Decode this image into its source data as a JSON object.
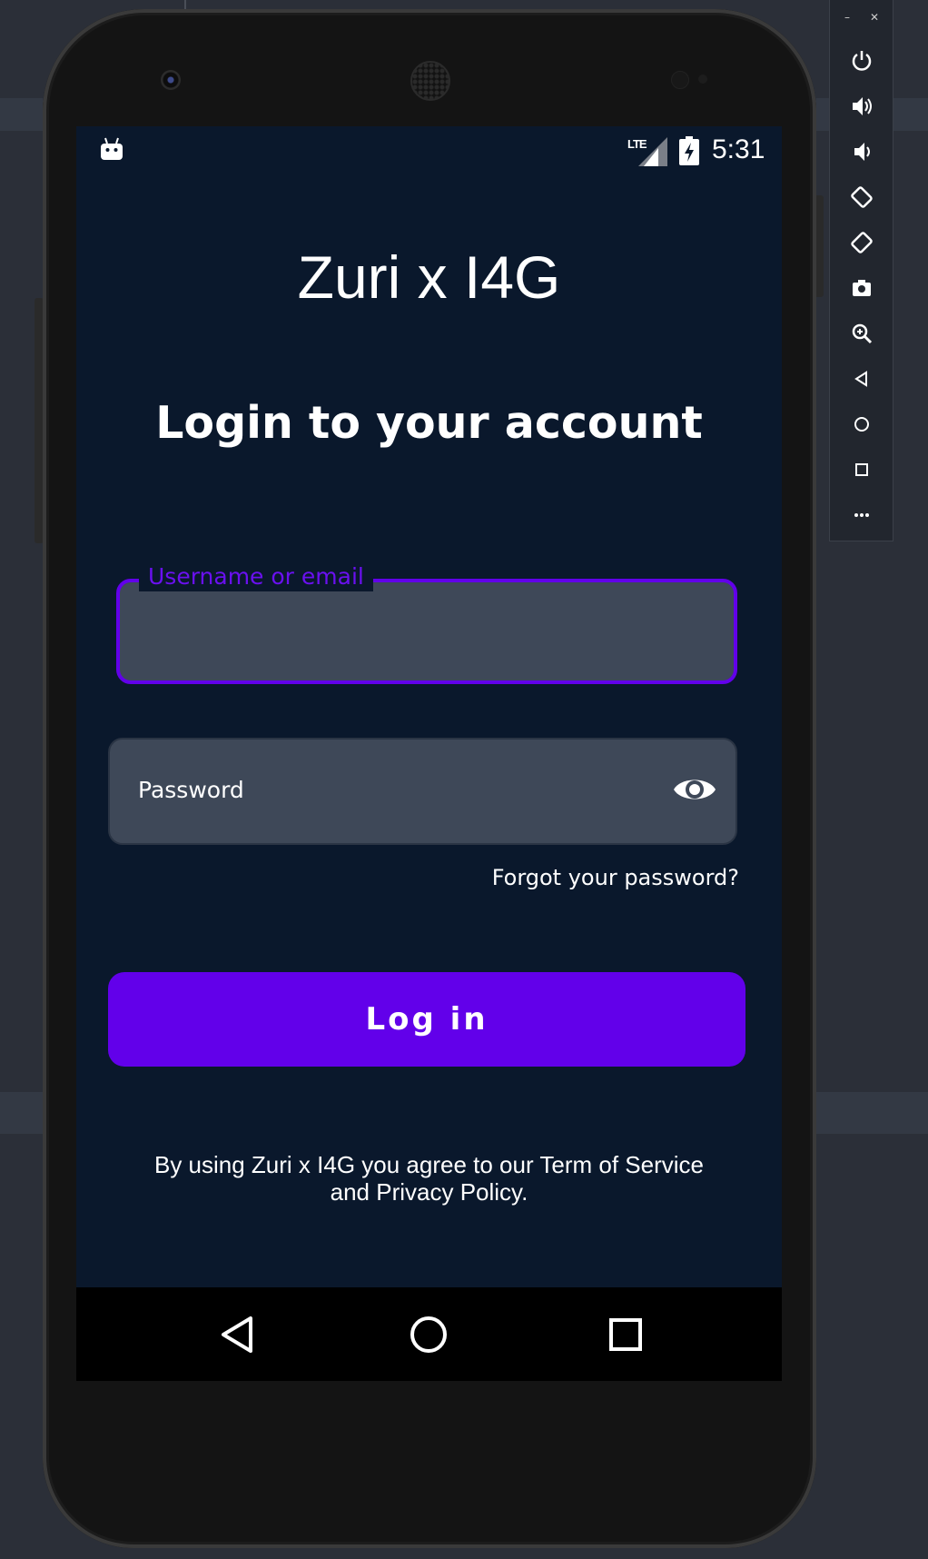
{
  "status_bar": {
    "network": "LTE",
    "time": "5:31"
  },
  "app": {
    "title": "Zuri x I4G",
    "heading": "Login to your account"
  },
  "form": {
    "username_label": "Username or email",
    "password_placeholder": "Password",
    "forgot_link": "Forgot your password?",
    "login_button": "Log in"
  },
  "footer": {
    "terms_line1": "By using Zuri x I4G you agree to our Term of Service",
    "terms_line2": "and Privacy Policy."
  },
  "colors": {
    "screen_bg": "#0a182c",
    "accent": "#6200ea",
    "input_bg": "#3e4858",
    "text": "#ffffff"
  },
  "emulator_toolbar": {
    "window_controls": [
      "minimize",
      "close"
    ],
    "icons": [
      "power-icon",
      "volume-up-icon",
      "volume-down-icon",
      "rotate-left-icon",
      "rotate-right-icon",
      "camera-icon",
      "zoom-icon",
      "back-icon",
      "home-icon",
      "overview-icon",
      "more-icon"
    ]
  }
}
